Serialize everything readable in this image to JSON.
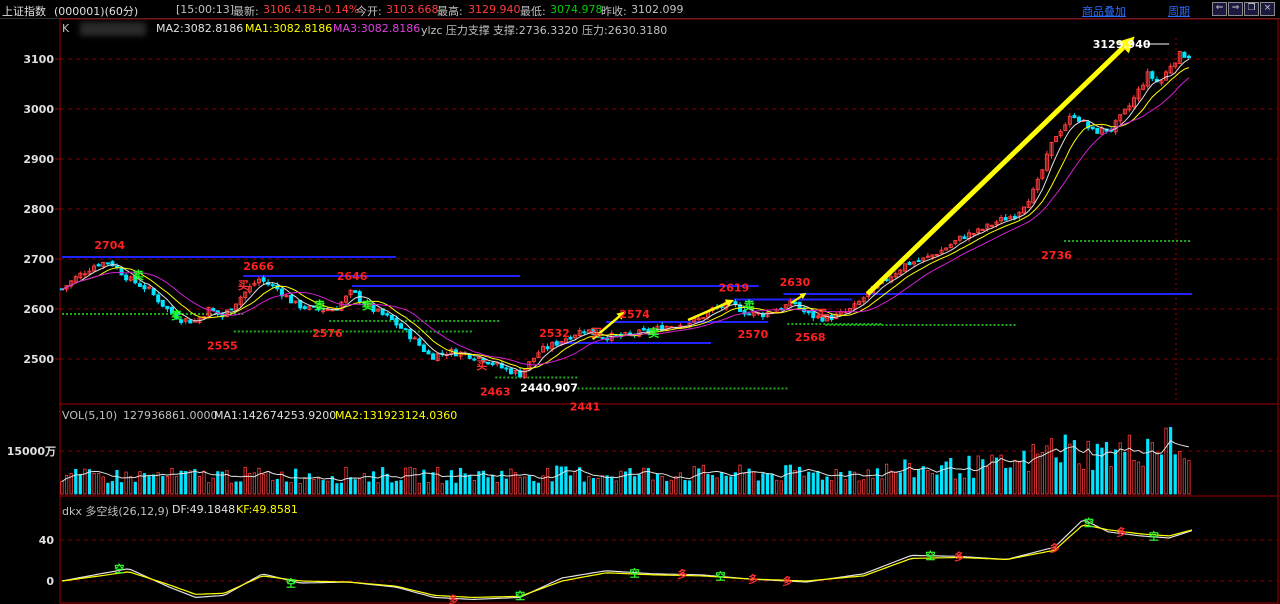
{
  "header": {
    "index_name": "上证指数",
    "code_period": "(000001)(60分)",
    "time": "[15:00:13]",
    "latest_label": "最新:",
    "latest_value": "3106.418",
    "change": "+0.14%",
    "open_label": "今开:",
    "open_value": "3103.668",
    "high_label": "最高:",
    "high_value": "3129.940",
    "low_label": "最低:",
    "low_value": "3074.978",
    "prev_close_label": "昨收:",
    "prev_close_value": "3102.099",
    "overlay_link": "商品叠加",
    "period_link": "周期"
  },
  "main_panel": {
    "label": "K",
    "ma2": "MA2:3082.8186",
    "ma1": "MA1:3082.8186",
    "ma3": "MA3:3082.8186",
    "indicator": "ylzc 压力支撑",
    "support": "支撑:2736.3320",
    "pressure": "压力:2630.3180",
    "y_ticks": [
      "3100",
      "3000",
      "2900",
      "2800",
      "2700",
      "2600",
      "2500"
    ],
    "max_label": "3129.940",
    "min_label": "2440.907",
    "buy_char": "买",
    "sell_char": "卖"
  },
  "vol_panel": {
    "title": "VOL(5,10)",
    "value": "127936861.0000",
    "ma1": "MA1:142674253.9200",
    "ma2": "MA2:131923124.0360",
    "y_tick": "15000万"
  },
  "dkx_panel": {
    "title": "dkx 多空线(26,12,9)",
    "df": "DF:49.1848",
    "kf": "KF:49.8581",
    "y_ticks": [
      "40",
      "0"
    ],
    "long_char": "多",
    "empty_char": "空"
  },
  "colors": {
    "up": "#ff3c3c",
    "down": "#00e4ff",
    "pressure_line": "#2222ff",
    "support_line": "#1faa1f",
    "arrow": "#ffff00",
    "grid": "#7a0000",
    "ma1": "#e0e0e0",
    "ma2": "#ffff00",
    "ma3": "#d020d0"
  },
  "chart_data": [
    {
      "type": "candlestick",
      "title": "上证指数(000001)(60分)",
      "y_unit": "index points",
      "ylim": [
        2440,
        3130
      ],
      "y_ticks": [
        2500,
        2600,
        2700,
        2800,
        2900,
        3000,
        3100
      ],
      "close_path": [
        [
          0,
          2640
        ],
        [
          8,
          2665
        ],
        [
          18,
          2690
        ],
        [
          25,
          2695
        ],
        [
          35,
          2660
        ],
        [
          45,
          2640
        ],
        [
          55,
          2600
        ],
        [
          62,
          2580
        ],
        [
          70,
          2575
        ],
        [
          77,
          2600
        ],
        [
          84,
          2585
        ],
        [
          95,
          2630
        ],
        [
          103,
          2660
        ],
        [
          113,
          2640
        ],
        [
          122,
          2610
        ],
        [
          132,
          2598
        ],
        [
          143,
          2600
        ],
        [
          152,
          2635
        ],
        [
          160,
          2605
        ],
        [
          172,
          2580
        ],
        [
          183,
          2545
        ],
        [
          193,
          2505
        ],
        [
          203,
          2515
        ],
        [
          212,
          2510
        ],
        [
          221,
          2500
        ],
        [
          232,
          2480
        ],
        [
          240,
          2470
        ],
        [
          250,
          2515
        ],
        [
          258,
          2530
        ],
        [
          268,
          2550
        ],
        [
          274,
          2560
        ],
        [
          282,
          2545
        ],
        [
          293,
          2545
        ],
        [
          300,
          2550
        ],
        [
          307,
          2555
        ],
        [
          316,
          2565
        ],
        [
          325,
          2570
        ],
        [
          333,
          2578
        ],
        [
          341,
          2600
        ],
        [
          351,
          2610
        ],
        [
          360,
          2590
        ],
        [
          368,
          2590
        ],
        [
          378,
          2605
        ],
        [
          384,
          2612
        ],
        [
          390,
          2590
        ],
        [
          397,
          2582
        ],
        [
          405,
          2585
        ],
        [
          414,
          2600
        ],
        [
          422,
          2630
        ],
        [
          432,
          2660
        ],
        [
          442,
          2690
        ],
        [
          452,
          2700
        ],
        [
          462,
          2720
        ],
        [
          472,
          2745
        ],
        [
          480,
          2755
        ],
        [
          490,
          2775
        ],
        [
          500,
          2790
        ],
        [
          510,
          2840
        ],
        [
          520,
          2945
        ],
        [
          530,
          2990
        ],
        [
          540,
          2955
        ],
        [
          550,
          2960
        ],
        [
          560,
          3010
        ],
        [
          569,
          3070
        ],
        [
          575,
          3050
        ],
        [
          581,
          3090
        ],
        [
          586,
          3110
        ],
        [
          592,
          3106
        ]
      ],
      "annotations": [
        {
          "label": "2704",
          "kind": "high",
          "value": 2704
        },
        {
          "label": "2666",
          "kind": "high",
          "value": 2666
        },
        {
          "label": "2646",
          "kind": "high",
          "value": 2646
        },
        {
          "label": "2532",
          "kind": "high",
          "value": 2532
        },
        {
          "label": "2574",
          "kind": "high",
          "value": 2574
        },
        {
          "label": "2619",
          "kind": "high",
          "value": 2619
        },
        {
          "label": "2630",
          "kind": "high",
          "value": 2630
        },
        {
          "label": "2555",
          "kind": "low",
          "value": 2555
        },
        {
          "label": "2576",
          "kind": "low",
          "value": 2576
        },
        {
          "label": "2463",
          "kind": "low",
          "value": 2463
        },
        {
          "label": "2441",
          "kind": "low",
          "value": 2441
        },
        {
          "label": "2570",
          "kind": "low",
          "value": 2570
        },
        {
          "label": "2568",
          "kind": "low",
          "value": 2568
        },
        {
          "label": "2736",
          "kind": "low",
          "value": 2736
        }
      ],
      "pressure_lines": [
        2704,
        2666,
        2646,
        2532,
        2574,
        2619,
        2630
      ],
      "support_lines": [
        2590,
        2555,
        2576,
        2463,
        2441,
        2570,
        2568,
        2736
      ]
    },
    {
      "type": "bar",
      "title": "VOL(5,10)",
      "y_unit": "万",
      "y_ticks": [
        15000
      ],
      "volume_path": [
        [
          0,
          6000
        ],
        [
          100,
          6500
        ],
        [
          200,
          6500
        ],
        [
          300,
          7000
        ],
        [
          400,
          7000
        ],
        [
          500,
          10000
        ],
        [
          520,
          16000
        ],
        [
          540,
          14000
        ],
        [
          560,
          15000
        ],
        [
          575,
          19000
        ],
        [
          592,
          12790
        ]
      ]
    },
    {
      "type": "line",
      "title": "dkx 多空线(26,12,9)",
      "y_ticks": [
        0,
        40
      ],
      "series": [
        {
          "name": "DF",
          "points": [
            [
              0,
              0
            ],
            [
              20,
              7
            ],
            [
              35,
              12
            ],
            [
              55,
              -5
            ],
            [
              70,
              -16
            ],
            [
              85,
              -14
            ],
            [
              105,
              7
            ],
            [
              125,
              -2
            ],
            [
              150,
              -1
            ],
            [
              175,
              -6
            ],
            [
              195,
              -16
            ],
            [
              215,
              -18
            ],
            [
              240,
              -16
            ],
            [
              262,
              3
            ],
            [
              285,
              10
            ],
            [
              310,
              7
            ],
            [
              335,
              6
            ],
            [
              360,
              2
            ],
            [
              390,
              -1
            ],
            [
              420,
              7
            ],
            [
              445,
              25
            ],
            [
              470,
              24
            ],
            [
              495,
              21
            ],
            [
              520,
              33
            ],
            [
              535,
              60
            ],
            [
              548,
              48
            ],
            [
              565,
              44
            ],
            [
              580,
              42
            ],
            [
              592,
              49.1848
            ]
          ]
        },
        {
          "name": "KF",
          "points": [
            [
              0,
              0
            ],
            [
              20,
              5
            ],
            [
              35,
              9
            ],
            [
              55,
              -3
            ],
            [
              70,
              -13
            ],
            [
              85,
              -12
            ],
            [
              105,
              5
            ],
            [
              125,
              0
            ],
            [
              150,
              -1
            ],
            [
              175,
              -5
            ],
            [
              195,
              -14
            ],
            [
              215,
              -16
            ],
            [
              240,
              -15
            ],
            [
              262,
              0
            ],
            [
              285,
              8
            ],
            [
              310,
              6
            ],
            [
              335,
              5
            ],
            [
              360,
              2
            ],
            [
              390,
              0
            ],
            [
              420,
              5
            ],
            [
              445,
              22
            ],
            [
              470,
              23
            ],
            [
              495,
              21
            ],
            [
              520,
              30
            ],
            [
              535,
              55
            ],
            [
              548,
              50
            ],
            [
              565,
              46
            ],
            [
              580,
              44
            ],
            [
              592,
              49.8581
            ]
          ]
        }
      ]
    }
  ]
}
